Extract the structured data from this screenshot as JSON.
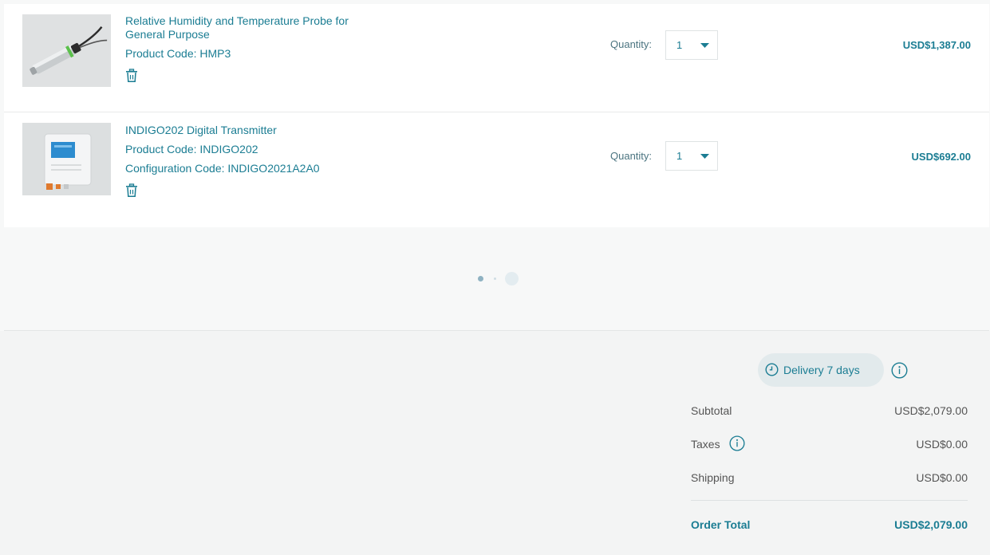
{
  "colors": {
    "accent": "#1b7d93",
    "background": "#f7f8f8"
  },
  "cart": {
    "items": [
      {
        "title_line1": "Relative Humidity and Temperature Probe for",
        "title_line2": "General Purpose",
        "product_code": "Product Code: HMP3",
        "quantity_label": "Quantity:",
        "quantity": "1",
        "price": "USD$1,387.00",
        "delete_icon": "trash-icon"
      },
      {
        "title_line1": "INDIGO202 Digital Transmitter",
        "product_code": "Product Code: INDIGO202",
        "configuration_code": "Configuration Code: INDIGO2021A2A0",
        "quantity_label": "Quantity:",
        "quantity": "1",
        "price": "USD$692.00",
        "delete_icon": "trash-icon"
      }
    ]
  },
  "summary": {
    "delivery": "Delivery 7 days",
    "subtotal_label": "Subtotal",
    "subtotal": "USD$2,079.00",
    "taxes_label": "Taxes",
    "taxes": "USD$0.00",
    "shipping_label": "Shipping",
    "shipping": "USD$0.00",
    "total_label": "Order Total",
    "total": "USD$2,079.00"
  }
}
